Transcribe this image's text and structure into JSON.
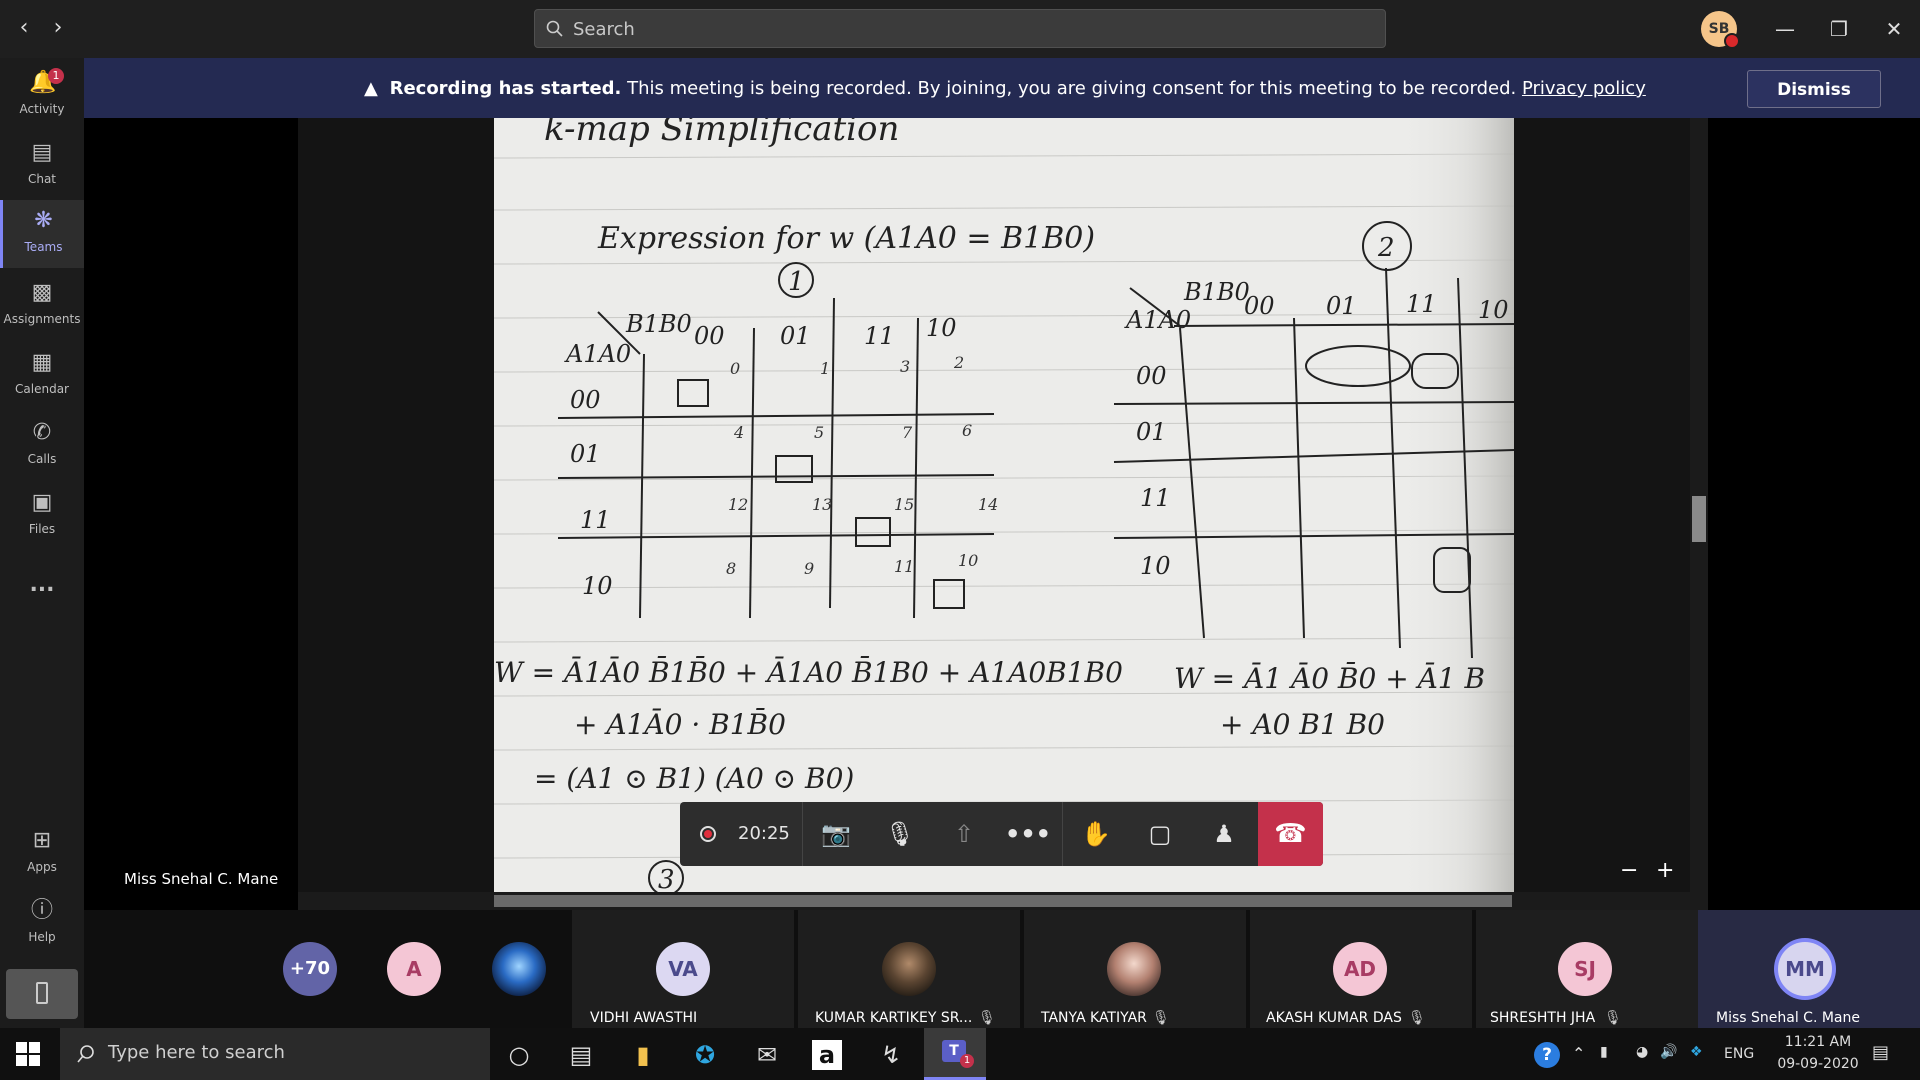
{
  "search": {
    "placeholder": "Search"
  },
  "user": {
    "initials": "SB"
  },
  "rail": {
    "items": [
      {
        "label": "Activity",
        "icon": "bell-icon",
        "badge": "1"
      },
      {
        "label": "Chat",
        "icon": "chat-icon"
      },
      {
        "label": "Teams",
        "icon": "teams-icon"
      },
      {
        "label": "Assignments",
        "icon": "assignments-icon"
      },
      {
        "label": "Calendar",
        "icon": "calendar-icon"
      },
      {
        "label": "Calls",
        "icon": "phone-icon"
      },
      {
        "label": "Files",
        "icon": "files-icon"
      }
    ],
    "more": "...",
    "bottom": [
      {
        "label": "Apps",
        "icon": "apps-icon"
      },
      {
        "label": "Help",
        "icon": "help-icon"
      }
    ]
  },
  "banner": {
    "bold": "Recording has started.",
    "text": " This meeting is being recorded. By joining, you are giving consent for this meeting to be recorded. ",
    "link": "Privacy policy",
    "dismiss": "Dismiss"
  },
  "presenter": "Miss Snehal C. Mane",
  "zoom": {
    "minus": "−",
    "plus": "+"
  },
  "call": {
    "timer": "20:25"
  },
  "overflow_count": "+70",
  "participants": [
    {
      "initials": "A",
      "name": ""
    },
    {
      "initials": "",
      "name": ""
    },
    {
      "initials": "VA",
      "name": "VIDHI AWASTHI"
    },
    {
      "initials": "",
      "name": "KUMAR KARTIKEY SR..."
    },
    {
      "initials": "",
      "name": "TANYA KATIYAR"
    },
    {
      "initials": "AD",
      "name": "AKASH KUMAR DAS"
    },
    {
      "initials": "SJ",
      "name": "SHRESHTH JHA"
    },
    {
      "initials": "MM",
      "name": "Miss Snehal C. Mane"
    }
  ],
  "notes": {
    "heading": "k-map Simplification",
    "expr": "Expression for w (A1A0 = B1B0)",
    "circle1": "1",
    "circle2": "2",
    "circle3": "3",
    "kmap_left": {
      "col_vars": "B1B0",
      "row_vars": "A1A0",
      "cols": [
        "00",
        "01",
        "11",
        "10"
      ],
      "rows": [
        "00",
        "01",
        "11",
        "10"
      ],
      "cell_index": [
        [
          "0",
          "1",
          "3",
          "2"
        ],
        [
          "4",
          "5",
          "7",
          "6"
        ],
        [
          "12",
          "13",
          "15",
          "14"
        ],
        [
          "8",
          "9",
          "11",
          "10"
        ]
      ],
      "ones": [
        [
          0,
          0
        ],
        [
          1,
          1
        ],
        [
          2,
          2
        ],
        [
          3,
          3
        ]
      ]
    },
    "kmap_right": {
      "col_vars": "B1B0",
      "row_vars": "A1A0",
      "cols": [
        "00",
        "01",
        "11",
        "10"
      ],
      "rows": [
        "00",
        "01",
        "11",
        "10"
      ]
    },
    "eq1": "W = Ā1Ā0 B̄1B̄0 + Ā1A0 B̄1B0 + A1A0B1B0",
    "eq2": "+ A1Ā0 · B1B̄0",
    "eq3": "= (A1 ⊙ B1) (A0 ⊙ B0)",
    "eq4": "W = Ā1 Ā0 B̄0 + Ā1 B",
    "eq5": "+ A0 B1 B0"
  },
  "taskbar": {
    "search_placeholder": "Type here to search",
    "teams_badge": "1",
    "lang": "ENG",
    "time": "11:21 AM",
    "date": "09-09-2020"
  }
}
